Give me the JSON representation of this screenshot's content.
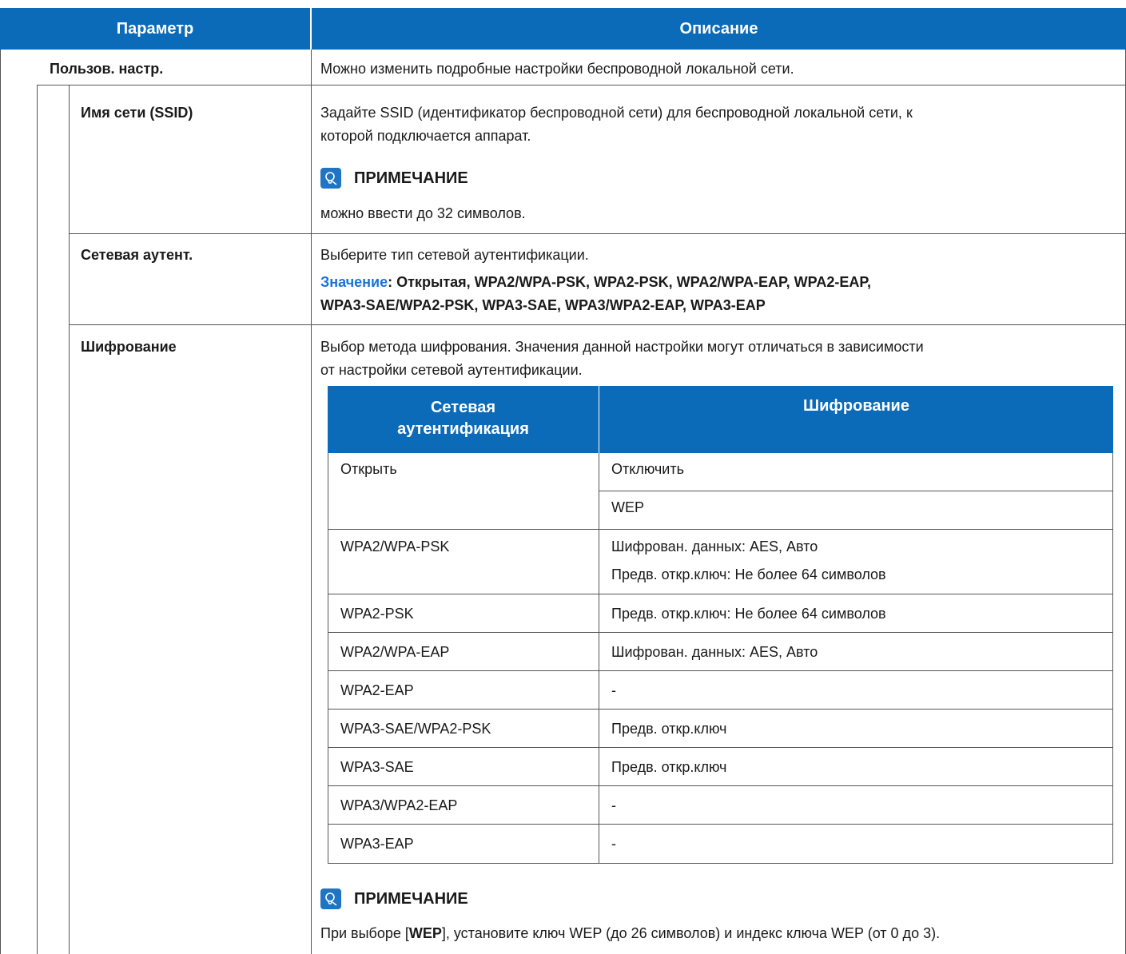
{
  "header": {
    "param": "Параметр",
    "desc": "Описание"
  },
  "rows": {
    "custom": {
      "name": "Пользов. настр.",
      "desc": "Можно изменить подробные настройки беспроводной локальной сети."
    },
    "ssid": {
      "name": "Имя сети (SSID)",
      "desc_line1": "Задайте SSID (идентификатор беспроводной сети) для беспроводной локальной сети, к",
      "desc_line2": "которой подключается аппарат.",
      "note_label": "ПРИМЕЧАНИЕ",
      "note_text": "можно ввести до 32 символов."
    },
    "auth": {
      "name": "Сетевая аутент.",
      "desc": "Выберите тип сетевой аутентификации.",
      "value_label": "Значение",
      "value_line1": ": Открытая, WPA2/WPA-PSK, WPA2-PSK, WPA2/WPA-EAP, WPA2-EAP,",
      "value_line2": "WPA3-SAE/WPA2-PSK, WPA3-SAE, WPA3/WPA2-EAP, WPA3-EAP"
    },
    "enc": {
      "name": "Шифрование",
      "desc_line1": "Выбор метода шифрования. Значения данной настройки могут отличаться в зависимости",
      "desc_line2": "от настройки сетевой аутентификации.",
      "note_label": "ПРИМЕЧАНИЕ",
      "note_pre": "При выборе [",
      "note_bold": "WEP",
      "note_post": "], установите ключ WEP (до 26 символов) и индекс ключа WEP (от 0 до 3)."
    }
  },
  "inner_table": {
    "col1_line1": "Сетевая",
    "col1_line2": "аутентификация",
    "col2": "Шифрование",
    "r0_auth": "Открыть",
    "r0_enc1": "Отключить",
    "r0_enc2": "WEP",
    "r1_auth": "WPA2/WPA-PSK",
    "r1_enc1": "Шифрован. данных: AES, Авто",
    "r1_enc2": "Предв. откр.ключ: Не более 64 символов",
    "r2_auth": "WPA2-PSK",
    "r2_enc": "Предв. откр.ключ: Не более 64 символов",
    "r3_auth": "WPA2/WPA-EAP",
    "r3_enc": "Шифрован. данных: AES, Авто",
    "r4_auth": "WPA2-EAP",
    "r4_enc": "-",
    "r5_auth": "WPA3-SAE/WPA2-PSK",
    "r5_enc": "Предв. откр.ключ",
    "r6_auth": "WPA3-SAE",
    "r6_enc": "Предв. откр.ключ",
    "r7_auth": "WPA3/WPA2-EAP",
    "r7_enc": "-",
    "r8_auth": "WPA3-EAP",
    "r8_enc": "-"
  },
  "icons": {
    "note": "lightbulb-note-icon"
  },
  "colors": {
    "header_bg": "#0b6bb8",
    "value_label": "#1a73d9",
    "icon_bg": "#1f74c4"
  }
}
